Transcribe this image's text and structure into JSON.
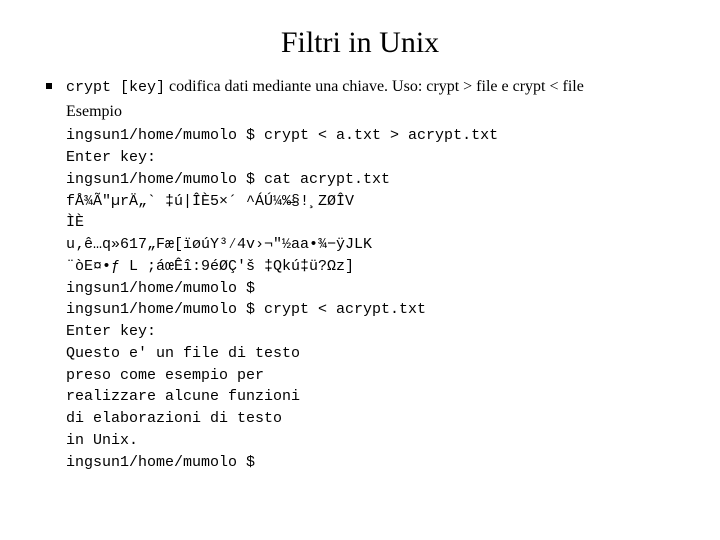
{
  "title": "Filtri in Unix",
  "bullet": {
    "cmd": "crypt [key]",
    "desc_rest": " codifica dati mediante una chiave. Uso: crypt > file e crypt < file"
  },
  "esempio_label": "Esempio",
  "terminal": "ingsun1/home/mumolo $ crypt < a.txt > acrypt.txt\nEnter key:\ningsun1/home/mumolo $ cat acrypt.txt\nfÅ¾Ã″µrÄ„` ‡ú|ÎÈ5×´ ^ÁÚ¼%̶§!¸ZØÎV\nÌÈ\nu‚ê…q»617„Fæ[ïøúY³⁄4v›¬\"½aa•¾−ÿJLK\n¨òE¤•ƒ L ;áœÊî:9éØÇ'š ‡Qkú‡ü?Ωz]\ningsun1/home/mumolo $\ningsun1/home/mumolo $ crypt < acrypt.txt\nEnter key:\nQuesto e' un file di testo\npreso come esempio per\nrealizzare alcune funzioni\ndi elaborazioni di testo\nin Unix.\ningsun1/home/mumolo $"
}
